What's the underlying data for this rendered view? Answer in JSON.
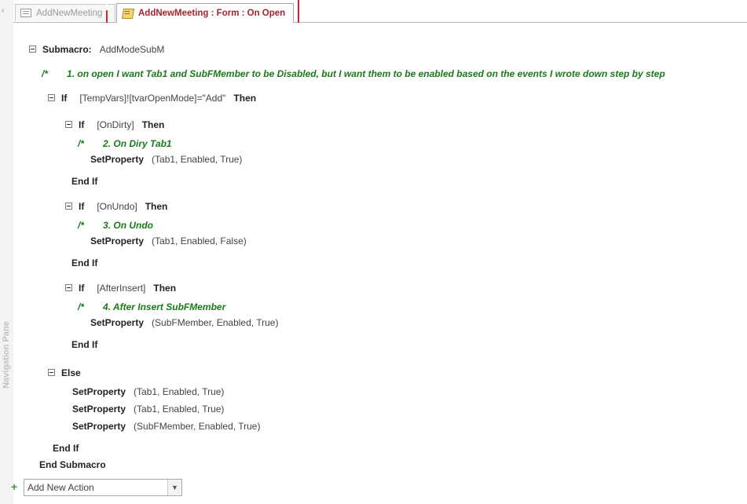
{
  "nav_pane": {
    "label": "Navigation Pane",
    "collapse_glyph": "‹"
  },
  "tabs": [
    {
      "label": "AddNewMeeting",
      "icon": "form-icon"
    },
    {
      "label": "AddNewMeeting : Form : On Open",
      "icon": "macro-icon"
    }
  ],
  "macro": {
    "submacro_keyword": "Submacro:",
    "submacro_name": "AddModeSubM",
    "comment_marker": "/*",
    "comment1": "1. on open I want Tab1 and SubFMember to be Disabled, but I want them to be enabled based on the events I wrote down step by step",
    "if_kw": "If",
    "then_kw": "Then",
    "if1_cond": "[TempVars]![tvarOpenMode]=\"Add\"",
    "if2_cond": "[OnDirty]",
    "comment2": "2. On Diry Tab1",
    "action2_name": "SetProperty",
    "action2_args": "(Tab1, Enabled, True)",
    "endif_kw": "End If",
    "if3_cond": "[OnUndo]",
    "comment3": "3. On Undo",
    "action3_name": "SetProperty",
    "action3_args": "(Tab1, Enabled, False)",
    "if4_cond": "[AfterInsert]",
    "comment4": "4. After Insert SubFMember",
    "action4_name": "SetProperty",
    "action4_args": "(SubFMember, Enabled, True)",
    "else_kw": "Else",
    "else_actions": [
      {
        "name": "SetProperty",
        "args": "(Tab1, Enabled, True)"
      },
      {
        "name": "SetProperty",
        "args": "(Tab1, Enabled, True)"
      },
      {
        "name": "SetProperty",
        "args": "(SubFMember, Enabled, True)"
      }
    ],
    "end_submacro_kw": "End Submacro"
  },
  "add_action": {
    "plus_glyph": "+",
    "placeholder": "Add New Action",
    "dropdown_glyph": "▼"
  },
  "colors": {
    "comment": "#1a7a1a",
    "active_tab_text": "#a4262c",
    "highlight": "#d9232e"
  }
}
